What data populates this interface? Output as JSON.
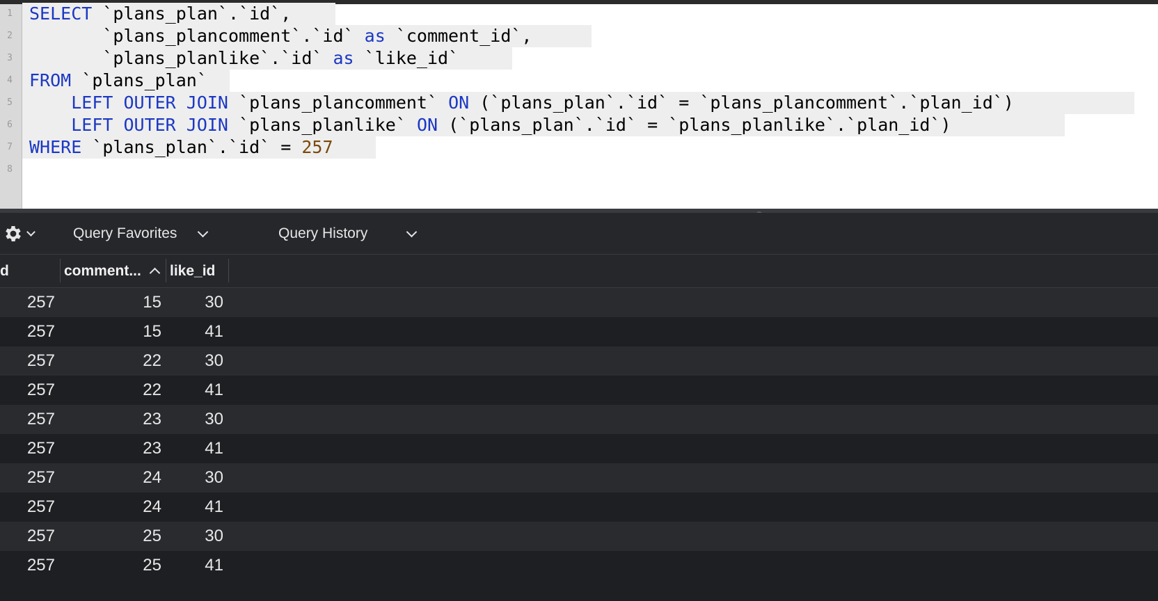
{
  "editor": {
    "line_numbers": [
      "1",
      "2",
      "3",
      "4",
      "5",
      "6",
      "7",
      "8"
    ],
    "lines": [
      [
        {
          "t": "SELECT",
          "k": "kw"
        },
        {
          "t": " `plans_plan`.`id`,",
          "k": ""
        }
      ],
      [
        {
          "t": "       `plans_plancomment`.`id` ",
          "k": ""
        },
        {
          "t": "as",
          "k": "kw"
        },
        {
          "t": " `comment_id`,",
          "k": ""
        }
      ],
      [
        {
          "t": "       `plans_planlike`.`id` ",
          "k": ""
        },
        {
          "t": "as",
          "k": "kw"
        },
        {
          "t": " `like_id`",
          "k": ""
        }
      ],
      [
        {
          "t": "FROM",
          "k": "kw"
        },
        {
          "t": " `plans_plan`",
          "k": ""
        }
      ],
      [
        {
          "t": "    ",
          "k": ""
        },
        {
          "t": "LEFT OUTER JOIN",
          "k": "kw"
        },
        {
          "t": " `plans_plancomment` ",
          "k": ""
        },
        {
          "t": "ON",
          "k": "kw"
        },
        {
          "t": " (`plans_plan`.`id` = `plans_plancomment`.`plan_id`)",
          "k": ""
        }
      ],
      [
        {
          "t": "    ",
          "k": ""
        },
        {
          "t": "LEFT OUTER JOIN",
          "k": "kw"
        },
        {
          "t": " `plans_planlike` ",
          "k": ""
        },
        {
          "t": "ON",
          "k": "kw"
        },
        {
          "t": " (`plans_plan`.`id` = `plans_planlike`.`plan_id`)",
          "k": ""
        }
      ],
      [
        {
          "t": "WHERE",
          "k": "kw"
        },
        {
          "t": " `plans_plan`.`id` = ",
          "k": ""
        },
        {
          "t": "257",
          "k": "num"
        }
      ],
      []
    ]
  },
  "toolbar": {
    "settings_icon": "gear-icon",
    "query_favorites_label": "Query Favorites",
    "query_history_label": "Query History"
  },
  "results": {
    "columns": [
      "d",
      "comment...",
      "like_id"
    ],
    "sorted_column_icon": "chevron-up-icon",
    "rows": [
      [
        "257",
        "15",
        "30"
      ],
      [
        "257",
        "15",
        "41"
      ],
      [
        "257",
        "22",
        "30"
      ],
      [
        "257",
        "22",
        "41"
      ],
      [
        "257",
        "23",
        "30"
      ],
      [
        "257",
        "23",
        "41"
      ],
      [
        "257",
        "24",
        "30"
      ],
      [
        "257",
        "24",
        "41"
      ],
      [
        "257",
        "25",
        "30"
      ],
      [
        "257",
        "25",
        "41"
      ]
    ]
  },
  "colors": {
    "keyword": "#1b38c4",
    "number": "#7a4a0a",
    "row_even": "#1e1f22",
    "row_odd": "#2a2b2f"
  }
}
